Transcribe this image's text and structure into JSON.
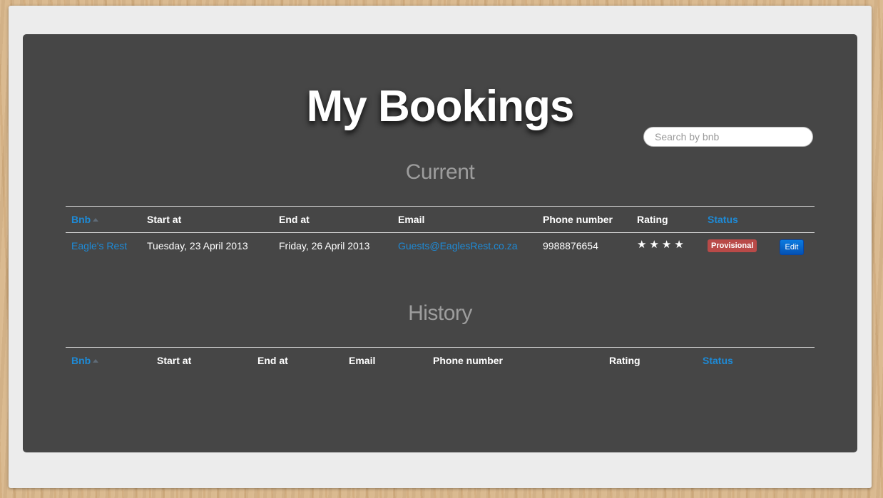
{
  "page_title": "My Bookings",
  "search": {
    "placeholder": "Search by bnb"
  },
  "current": {
    "heading": "Current",
    "columns": {
      "bnb": "Bnb",
      "start_at": "Start at",
      "end_at": "End at",
      "email": "Email",
      "phone": "Phone number",
      "rating": "Rating",
      "status": "Status"
    },
    "rows": [
      {
        "bnb": "Eagle's Rest",
        "start_at": "Tuesday, 23 April 2013",
        "end_at": "Friday, 26 April 2013",
        "email": "Guests@EaglesRest.co.za",
        "phone": "9988876654",
        "rating_stars": "★★★★",
        "rating_value": 4,
        "status": "Provisional",
        "edit_label": "Edit"
      }
    ]
  },
  "history": {
    "heading": "History",
    "columns": {
      "bnb": "Bnb",
      "start_at": "Start at",
      "end_at": "End at",
      "email": "Email",
      "phone": "Phone number",
      "rating": "Rating",
      "status": "Status"
    },
    "rows": []
  },
  "colors": {
    "panel": "#464646",
    "link": "#1e8ad6",
    "status_badge": "#b94a48",
    "edit_button": "#0b7be0"
  }
}
